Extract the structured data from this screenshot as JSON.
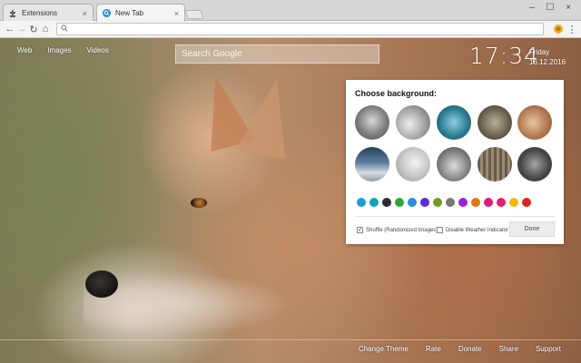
{
  "browser": {
    "tabs": [
      {
        "title": "Extensions",
        "icon": "puzzle-icon",
        "close": "×"
      },
      {
        "title": "New Tab",
        "icon": "search-favicon-icon",
        "close": "×"
      }
    ],
    "window_controls": {
      "minimize": "–",
      "maximize": "☐",
      "close": "×"
    },
    "toolbar": {
      "back": "←",
      "forward": "→",
      "reload": "↻",
      "home": "⌂",
      "omnibox_value": "",
      "menu": "⋮"
    }
  },
  "page": {
    "top_links": [
      "Web",
      "Images",
      "Videos"
    ],
    "search": {
      "placeholder": "Search Google"
    },
    "clock": {
      "time": "17:34",
      "day": "Friday",
      "date": "16.12.2016"
    },
    "background_panel": {
      "title": "Choose background:",
      "thumbnails": [
        "wolf-photo-1",
        "wolf-photo-2",
        "wolf-photo-3",
        "wolf-photo-4",
        "wolf-photo-5",
        "wolf-photo-6",
        "wolf-photo-7",
        "wolf-photo-8",
        "wolf-photo-9",
        "wolf-photo-10"
      ],
      "color_swatches": [
        "#1e9ad6",
        "#13a3b4",
        "#2b2b2b",
        "#2ea836",
        "#2b8be0",
        "#5b2bd0",
        "#6f9b2a",
        "#777777",
        "#9b23d6",
        "#e07a16",
        "#e0197e",
        "#e3206d",
        "#f0b70f",
        "#e0241f"
      ],
      "shuffle": {
        "label": "Shuffle (Randomized Images)",
        "checked": true
      },
      "weather": {
        "label": "Disable Weather Indicator",
        "checked": false
      },
      "done_label": "Done"
    },
    "footer_links": [
      "Change Theme",
      "Rate",
      "Donate",
      "Share",
      "Support"
    ]
  }
}
